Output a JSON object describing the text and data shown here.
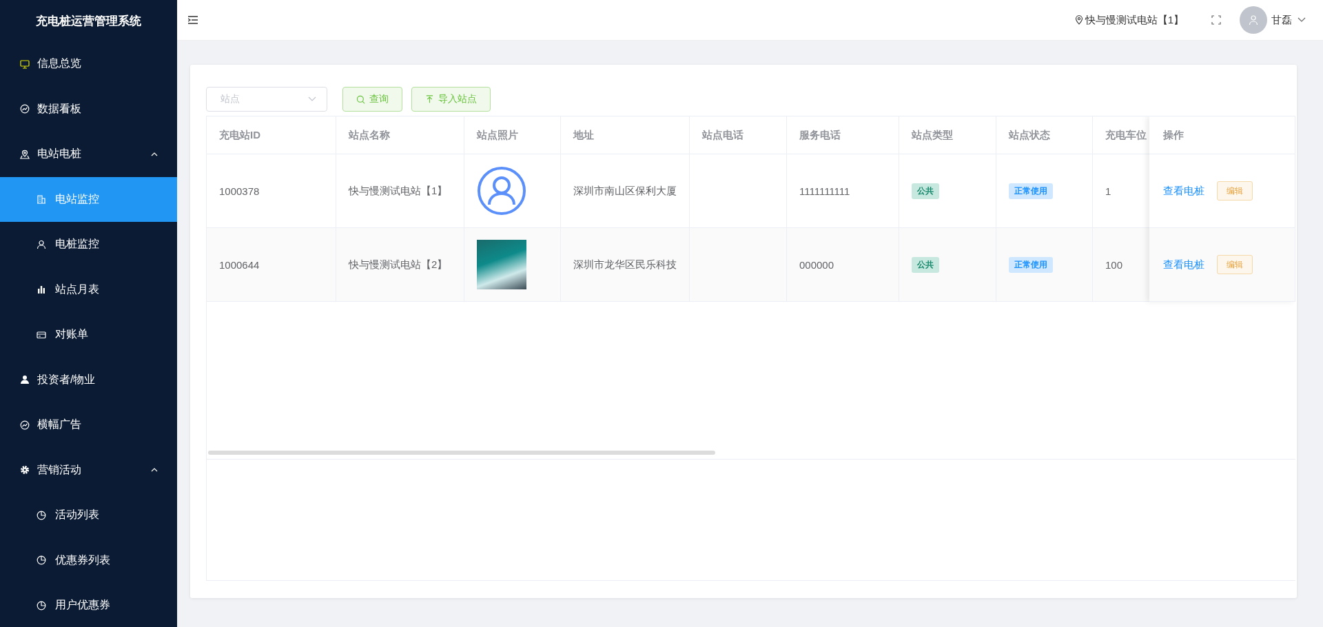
{
  "sidebar": {
    "title": "充电桩运营管理系统",
    "items": [
      {
        "label": "信息总览",
        "selected": false
      },
      {
        "label": "数据看板",
        "selected": false
      },
      {
        "label": "电站电桩",
        "selected": false,
        "expanded": true,
        "children": [
          {
            "label": "电站监控",
            "selected": true
          },
          {
            "label": "电桩监控",
            "selected": false
          },
          {
            "label": "站点月表",
            "selected": false
          },
          {
            "label": "对账单",
            "selected": false
          }
        ]
      },
      {
        "label": "投资者/物业",
        "selected": false
      },
      {
        "label": "横幅广告",
        "selected": false
      },
      {
        "label": "营销活动",
        "selected": false,
        "expanded": true,
        "children": [
          {
            "label": "活动列表",
            "selected": false
          },
          {
            "label": "优惠券列表",
            "selected": false
          },
          {
            "label": "用户优惠券",
            "selected": false
          }
        ]
      }
    ]
  },
  "header": {
    "location": "快与慢测试电站【1】",
    "user": "甘磊"
  },
  "filter": {
    "station_select": {
      "placeholder": "站点"
    },
    "buttons": [
      "查询",
      "导入站点"
    ]
  },
  "table": {
    "columns": [
      "充电站ID",
      "站点名称",
      "站点照片",
      "地址",
      "站点电话",
      "服务电话",
      "站点类型",
      "站点状态",
      "充电车位"
    ],
    "action_column": "操作",
    "rows": [
      {
        "id": "1000378",
        "name": "快与慢测试电站【1】",
        "photo": {
          "kind": "icon"
        },
        "address": "深圳市南山区保利大厦",
        "service_phone": "1111111111",
        "type": "公共",
        "status": "正常使用",
        "parking": "1",
        "actions": [
          "查看电桩",
          "编辑"
        ]
      },
      {
        "id": "1000644",
        "name": "快与慢测试电站【2】",
        "photo": {
          "kind": "photo"
        },
        "address": "深圳市龙华区民乐科技",
        "service_phone": "000000",
        "type": "公共",
        "status": "正常使用",
        "parking": "100",
        "actions": [
          "查看电桩",
          "编辑"
        ]
      }
    ]
  }
}
